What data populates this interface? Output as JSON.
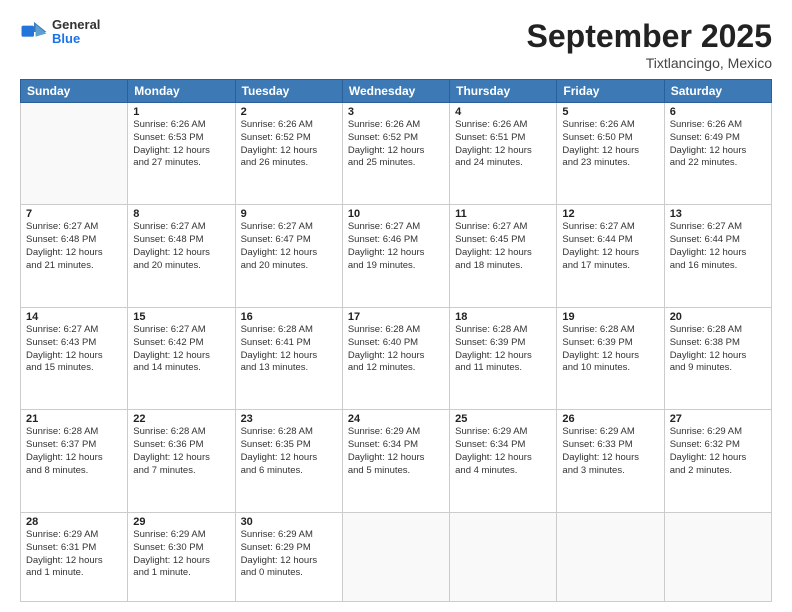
{
  "logo": {
    "general": "General",
    "blue": "Blue"
  },
  "title": "September 2025",
  "location": "Tixtlancingo, Mexico",
  "days_of_week": [
    "Sunday",
    "Monday",
    "Tuesday",
    "Wednesday",
    "Thursday",
    "Friday",
    "Saturday"
  ],
  "weeks": [
    [
      {
        "day": "",
        "info": ""
      },
      {
        "day": "1",
        "info": "Sunrise: 6:26 AM\nSunset: 6:53 PM\nDaylight: 12 hours\nand 27 minutes."
      },
      {
        "day": "2",
        "info": "Sunrise: 6:26 AM\nSunset: 6:52 PM\nDaylight: 12 hours\nand 26 minutes."
      },
      {
        "day": "3",
        "info": "Sunrise: 6:26 AM\nSunset: 6:52 PM\nDaylight: 12 hours\nand 25 minutes."
      },
      {
        "day": "4",
        "info": "Sunrise: 6:26 AM\nSunset: 6:51 PM\nDaylight: 12 hours\nand 24 minutes."
      },
      {
        "day": "5",
        "info": "Sunrise: 6:26 AM\nSunset: 6:50 PM\nDaylight: 12 hours\nand 23 minutes."
      },
      {
        "day": "6",
        "info": "Sunrise: 6:26 AM\nSunset: 6:49 PM\nDaylight: 12 hours\nand 22 minutes."
      }
    ],
    [
      {
        "day": "7",
        "info": "Sunrise: 6:27 AM\nSunset: 6:48 PM\nDaylight: 12 hours\nand 21 minutes."
      },
      {
        "day": "8",
        "info": "Sunrise: 6:27 AM\nSunset: 6:48 PM\nDaylight: 12 hours\nand 20 minutes."
      },
      {
        "day": "9",
        "info": "Sunrise: 6:27 AM\nSunset: 6:47 PM\nDaylight: 12 hours\nand 20 minutes."
      },
      {
        "day": "10",
        "info": "Sunrise: 6:27 AM\nSunset: 6:46 PM\nDaylight: 12 hours\nand 19 minutes."
      },
      {
        "day": "11",
        "info": "Sunrise: 6:27 AM\nSunset: 6:45 PM\nDaylight: 12 hours\nand 18 minutes."
      },
      {
        "day": "12",
        "info": "Sunrise: 6:27 AM\nSunset: 6:44 PM\nDaylight: 12 hours\nand 17 minutes."
      },
      {
        "day": "13",
        "info": "Sunrise: 6:27 AM\nSunset: 6:44 PM\nDaylight: 12 hours\nand 16 minutes."
      }
    ],
    [
      {
        "day": "14",
        "info": "Sunrise: 6:27 AM\nSunset: 6:43 PM\nDaylight: 12 hours\nand 15 minutes."
      },
      {
        "day": "15",
        "info": "Sunrise: 6:27 AM\nSunset: 6:42 PM\nDaylight: 12 hours\nand 14 minutes."
      },
      {
        "day": "16",
        "info": "Sunrise: 6:28 AM\nSunset: 6:41 PM\nDaylight: 12 hours\nand 13 minutes."
      },
      {
        "day": "17",
        "info": "Sunrise: 6:28 AM\nSunset: 6:40 PM\nDaylight: 12 hours\nand 12 minutes."
      },
      {
        "day": "18",
        "info": "Sunrise: 6:28 AM\nSunset: 6:39 PM\nDaylight: 12 hours\nand 11 minutes."
      },
      {
        "day": "19",
        "info": "Sunrise: 6:28 AM\nSunset: 6:39 PM\nDaylight: 12 hours\nand 10 minutes."
      },
      {
        "day": "20",
        "info": "Sunrise: 6:28 AM\nSunset: 6:38 PM\nDaylight: 12 hours\nand 9 minutes."
      }
    ],
    [
      {
        "day": "21",
        "info": "Sunrise: 6:28 AM\nSunset: 6:37 PM\nDaylight: 12 hours\nand 8 minutes."
      },
      {
        "day": "22",
        "info": "Sunrise: 6:28 AM\nSunset: 6:36 PM\nDaylight: 12 hours\nand 7 minutes."
      },
      {
        "day": "23",
        "info": "Sunrise: 6:28 AM\nSunset: 6:35 PM\nDaylight: 12 hours\nand 6 minutes."
      },
      {
        "day": "24",
        "info": "Sunrise: 6:29 AM\nSunset: 6:34 PM\nDaylight: 12 hours\nand 5 minutes."
      },
      {
        "day": "25",
        "info": "Sunrise: 6:29 AM\nSunset: 6:34 PM\nDaylight: 12 hours\nand 4 minutes."
      },
      {
        "day": "26",
        "info": "Sunrise: 6:29 AM\nSunset: 6:33 PM\nDaylight: 12 hours\nand 3 minutes."
      },
      {
        "day": "27",
        "info": "Sunrise: 6:29 AM\nSunset: 6:32 PM\nDaylight: 12 hours\nand 2 minutes."
      }
    ],
    [
      {
        "day": "28",
        "info": "Sunrise: 6:29 AM\nSunset: 6:31 PM\nDaylight: 12 hours\nand 1 minute."
      },
      {
        "day": "29",
        "info": "Sunrise: 6:29 AM\nSunset: 6:30 PM\nDaylight: 12 hours\nand 1 minute."
      },
      {
        "day": "30",
        "info": "Sunrise: 6:29 AM\nSunset: 6:29 PM\nDaylight: 12 hours\nand 0 minutes."
      },
      {
        "day": "",
        "info": ""
      },
      {
        "day": "",
        "info": ""
      },
      {
        "day": "",
        "info": ""
      },
      {
        "day": "",
        "info": ""
      }
    ]
  ]
}
